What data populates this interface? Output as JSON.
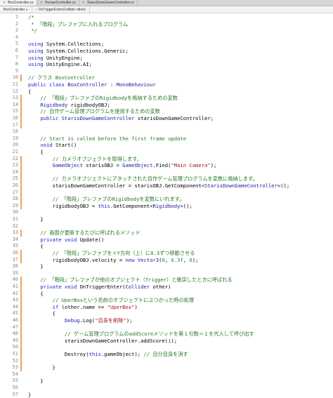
{
  "tabs": [
    {
      "label": "BoxController.cs",
      "active": true
    },
    {
      "label": "HumanController.cs",
      "active": false
    },
    {
      "label": "StairsDownGameController.cs",
      "active": false
    }
  ],
  "navbar": {
    "class_selector": "BoxController",
    "method_selector": "OnTriggerEnter(Collider other)"
  },
  "colors": {
    "keyword": "#1c1ccf",
    "comment": "#267a26",
    "string": "#a3161a",
    "number": "#0f7a7a",
    "change_marker": "#f0a35a"
  },
  "lines": [
    {
      "n": "1",
      "tokens": [
        [
          "c",
          "/*"
        ]
      ]
    },
    {
      "n": "2",
      "tokens": [
        [
          "c",
          " * 「階段」プレファブに入れるプログラム"
        ]
      ]
    },
    {
      "n": "3",
      "tokens": [
        [
          "c",
          " */"
        ]
      ]
    },
    {
      "n": "4",
      "tokens": []
    },
    {
      "n": "5",
      "tokens": [
        [
          "k",
          "using"
        ],
        [
          "p",
          " System.Collections;"
        ]
      ]
    },
    {
      "n": "6",
      "tokens": [
        [
          "k",
          "using"
        ],
        [
          "p",
          " System.Collections.Generic;"
        ]
      ]
    },
    {
      "n": "7",
      "tokens": [
        [
          "k",
          "using"
        ],
        [
          "p",
          " UnityEngine;"
        ]
      ]
    },
    {
      "n": "8",
      "tokens": [
        [
          "k",
          "using"
        ],
        [
          "p",
          " UnityEngine.AI;"
        ]
      ]
    },
    {
      "n": "9",
      "tokens": []
    },
    {
      "n": "10",
      "tokens": [
        [
          "c",
          "// クラス BoxController"
        ]
      ],
      "mark": true
    },
    {
      "n": "11",
      "tokens": [
        [
          "k",
          "public"
        ],
        [
          "p",
          " "
        ],
        [
          "k",
          "class"
        ],
        [
          "p",
          " "
        ],
        [
          "t",
          "BoxController"
        ],
        [
          "p",
          " : "
        ],
        [
          "t",
          "MonoBehaviour"
        ]
      ]
    },
    {
      "n": "12",
      "tokens": [
        [
          "p",
          "{"
        ]
      ]
    },
    {
      "n": "13",
      "tokens": [
        [
          "c",
          "    // 「階段」プレファブのRigidbodyを格納するための変数"
        ]
      ],
      "mark": true
    },
    {
      "n": "14",
      "tokens": [
        [
          "p",
          "    "
        ],
        [
          "t",
          "Rigidbody"
        ],
        [
          "p",
          " rigidbodyOBJ;"
        ]
      ],
      "mark": true
    },
    {
      "n": "15",
      "tokens": [
        [
          "c",
          "    // 自作ゲーム管理プログラムを使用するための変数"
        ]
      ],
      "mark": true
    },
    {
      "n": "16",
      "tokens": [
        [
          "p",
          "    "
        ],
        [
          "k",
          "public"
        ],
        [
          "p",
          " "
        ],
        [
          "t",
          "StarisDownGameController"
        ],
        [
          "p",
          " starisDownGameController;"
        ]
      ],
      "mark": true
    },
    {
      "n": "17",
      "tokens": [],
      "mark": true
    },
    {
      "n": "18",
      "tokens": []
    },
    {
      "n": "19",
      "tokens": [
        [
          "c",
          "    // Start is called before the first frame update"
        ]
      ]
    },
    {
      "n": "20",
      "tokens": [
        [
          "p",
          "    "
        ],
        [
          "k",
          "void"
        ],
        [
          "p",
          " Start()"
        ]
      ]
    },
    {
      "n": "21",
      "tokens": [
        [
          "p",
          "    {"
        ]
      ]
    },
    {
      "n": "22",
      "tokens": [
        [
          "c",
          "        // カメラオブジェクトを取得します。"
        ]
      ],
      "mark": true
    },
    {
      "n": "23",
      "tokens": [
        [
          "p",
          "        "
        ],
        [
          "t",
          "GameObject"
        ],
        [
          "p",
          " starisOBJ = "
        ],
        [
          "t",
          "GameObject"
        ],
        [
          "p",
          ".Find("
        ],
        [
          "s",
          "\"Main Camera\""
        ],
        [
          "p",
          ");"
        ]
      ],
      "mark": true
    },
    {
      "n": "24",
      "tokens": [],
      "mark": true
    },
    {
      "n": "25",
      "tokens": [
        [
          "c",
          "        // カメラオブジェクトにアタッチされた自作ゲーム管理プログラムを変数に格納します。"
        ]
      ],
      "mark": true
    },
    {
      "n": "26",
      "tokens": [
        [
          "p",
          "        starisDownGameController = starisOBJ.GetComponent<"
        ],
        [
          "t",
          "StarisDownGameController"
        ],
        [
          "p",
          ">();"
        ]
      ],
      "mark": true
    },
    {
      "n": "27",
      "tokens": [],
      "mark": true
    },
    {
      "n": "28",
      "tokens": [
        [
          "c",
          "        // 「階段」プレファブのRigidbodyを変数にいれます。"
        ]
      ],
      "mark": true
    },
    {
      "n": "29",
      "tokens": [
        [
          "p",
          "        rigidbodyOBJ = "
        ],
        [
          "k",
          "this"
        ],
        [
          "p",
          ".GetComponent<"
        ],
        [
          "t",
          "Rigidbody"
        ],
        [
          "p",
          ">();"
        ]
      ],
      "mark": true
    },
    {
      "n": "30",
      "tokens": []
    },
    {
      "n": "31",
      "tokens": [
        [
          "p",
          "    }"
        ]
      ]
    },
    {
      "n": "32",
      "tokens": []
    },
    {
      "n": "33",
      "tokens": [
        [
          "c",
          "    // 画面が更新するたびに呼ばれるメソッド"
        ]
      ],
      "mark": true
    },
    {
      "n": "34",
      "tokens": [
        [
          "p",
          "    "
        ],
        [
          "k",
          "private"
        ],
        [
          "p",
          " "
        ],
        [
          "k",
          "void"
        ],
        [
          "p",
          " Update()"
        ]
      ]
    },
    {
      "n": "35",
      "tokens": [
        [
          "p",
          "    {"
        ]
      ]
    },
    {
      "n": "36",
      "tokens": [
        [
          "c",
          "        // 「階段」プレファブを＋Y方向（上）に0.3ずつ移動させる"
        ]
      ],
      "mark": true
    },
    {
      "n": "37",
      "tokens": [
        [
          "p",
          "        rigidbodyOBJ.velocity = "
        ],
        [
          "k",
          "new"
        ],
        [
          "p",
          " "
        ],
        [
          "t",
          "Vector3"
        ],
        [
          "p",
          "("
        ],
        [
          "n",
          "0"
        ],
        [
          "p",
          ", "
        ],
        [
          "n",
          "0.3f"
        ],
        [
          "p",
          ", "
        ],
        [
          "n",
          "0"
        ],
        [
          "p",
          ");"
        ]
      ],
      "mark": true
    },
    {
      "n": "38",
      "tokens": [
        [
          "p",
          "    }"
        ]
      ]
    },
    {
      "n": "39",
      "tokens": []
    },
    {
      "n": "40",
      "tokens": [
        [
          "c",
          "    // 「階段」プレファブが他のオブジェクト（Trigger）と衝突したときに呼ばれる"
        ]
      ],
      "mark": true
    },
    {
      "n": "41",
      "tokens": [
        [
          "p",
          "    "
        ],
        [
          "k",
          "private"
        ],
        [
          "p",
          " "
        ],
        [
          "k",
          "void"
        ],
        [
          "p",
          " OnTriggerEnter("
        ],
        [
          "t",
          "Collider"
        ],
        [
          "p",
          " other)"
        ]
      ],
      "mark": true
    },
    {
      "n": "42",
      "tokens": [
        [
          "p",
          "    {"
        ]
      ],
      "mark": true
    },
    {
      "n": "43",
      "tokens": [
        [
          "c",
          "        // UperBoxという名前のオブジェクトにぶつかった時の処理"
        ]
      ],
      "mark": true
    },
    {
      "n": "44",
      "tokens": [
        [
          "p",
          "        "
        ],
        [
          "k",
          "if"
        ],
        [
          "p",
          " (other.name == "
        ],
        [
          "s",
          "\"UperBox\""
        ],
        [
          "p",
          ")"
        ]
      ],
      "mark": true
    },
    {
      "n": "45",
      "tokens": [
        [
          "p",
          "        {"
        ]
      ],
      "mark": true
    },
    {
      "n": "46",
      "tokens": [
        [
          "p",
          "            "
        ],
        [
          "t",
          "Debug"
        ],
        [
          "p",
          ".Log("
        ],
        [
          "s",
          "\"自身を削除\""
        ],
        [
          "p",
          ");"
        ]
      ],
      "mark": true
    },
    {
      "n": "47",
      "tokens": [],
      "mark": true
    },
    {
      "n": "48",
      "tokens": [
        [
          "c",
          "            // ゲーム管理プログラムのaddScoreメソッドを第１引数＝１を代入して呼び出す"
        ]
      ],
      "mark": true
    },
    {
      "n": "49",
      "tokens": [
        [
          "p",
          "            starisDownGameController.addScore("
        ],
        [
          "n",
          "1"
        ],
        [
          "p",
          ");"
        ]
      ],
      "mark": true
    },
    {
      "n": "50",
      "tokens": [],
      "mark": true
    },
    {
      "n": "51",
      "tokens": [
        [
          "p",
          "            Destroy("
        ],
        [
          "k",
          "this"
        ],
        [
          "p",
          ".gameObject); "
        ],
        [
          "c",
          "// 自分自身を消す"
        ]
      ],
      "mark": true
    },
    {
      "n": "52",
      "tokens": [],
      "mark": true
    },
    {
      "n": "53",
      "tokens": [
        [
          "p",
          "        }"
        ]
      ],
      "mark": true
    },
    {
      "n": "54",
      "tokens": []
    },
    {
      "n": "55",
      "tokens": [
        [
          "p",
          "    }"
        ]
      ]
    },
    {
      "n": "56",
      "tokens": []
    },
    {
      "n": "57",
      "tokens": [
        [
          "p",
          "}"
        ]
      ]
    }
  ]
}
